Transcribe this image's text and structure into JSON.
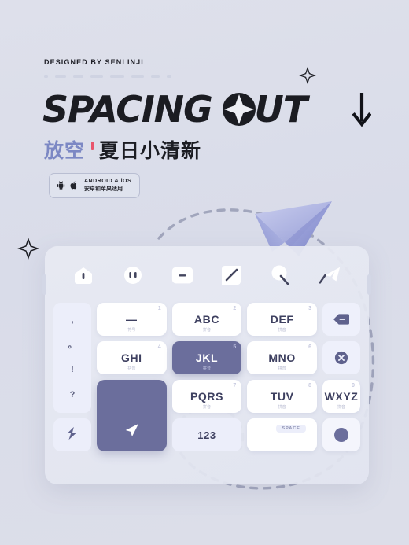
{
  "poster": {
    "background_color": "#dcdfea",
    "credit": "DESIGNED BY SENLINJI",
    "title_part1": "SPACING",
    "title_part2_before": "",
    "title_part2_after": "UT",
    "subtitle_accent": "放空",
    "subtitle_main": "夏日小清新",
    "accent_color": "#7c88c4",
    "tick_color": "#e9556d",
    "ink_color": "#1b1c22"
  },
  "badge": {
    "android_icon": "android-icon",
    "apple_icon": "apple-icon",
    "line_en": "ANDROID & iOS",
    "line_cn": "安卓和苹果适用"
  },
  "decorations": {
    "sparkle_top_right": "sparkle-icon",
    "sparkle_left": "sparkle-icon",
    "arrow_down": "arrow-down-icon",
    "paper_plane": "paper-plane-graphic",
    "dashed_trail": "dashed-trail"
  },
  "keyboard": {
    "toolbar": [
      {
        "name": "home-icon",
        "label": ""
      },
      {
        "name": "emoji-icon",
        "label": ""
      },
      {
        "name": "minimize-icon",
        "label": ""
      },
      {
        "name": "edit-icon",
        "label": ""
      },
      {
        "name": "search-icon",
        "label": ""
      },
      {
        "name": "send-icon",
        "label": ""
      }
    ],
    "punctuation_key": {
      "name": "punctuation-key",
      "symbols": [
        ",",
        "。",
        "!",
        "?"
      ]
    },
    "rows": [
      [
        {
          "main": "—",
          "corner": "1",
          "sub": "符号",
          "active": false,
          "name": "key-1"
        },
        {
          "main": "ABC",
          "corner": "2",
          "sub": "拼音",
          "active": false,
          "name": "key-abc"
        },
        {
          "main": "DEF",
          "corner": "3",
          "sub": "拼音",
          "active": false,
          "name": "key-def"
        }
      ],
      [
        {
          "main": "GHI",
          "corner": "4",
          "sub": "拼音",
          "active": false,
          "name": "key-ghi"
        },
        {
          "main": "JKL",
          "corner": "5",
          "sub": "拼音",
          "active": true,
          "name": "key-jkl"
        },
        {
          "main": "MNO",
          "corner": "6",
          "sub": "拼音",
          "active": false,
          "name": "key-mno"
        }
      ],
      [
        {
          "main": "PQRS",
          "corner": "7",
          "sub": "拼音",
          "active": false,
          "name": "key-pqrs"
        },
        {
          "main": "TUV",
          "corner": "8",
          "sub": "拼音",
          "active": false,
          "name": "key-tuv"
        },
        {
          "main": "WXYZ",
          "corner": "9",
          "sub": "拼音",
          "active": false,
          "name": "key-wxyz"
        }
      ]
    ],
    "right_column": [
      {
        "name": "backspace-key",
        "icon": "backspace-icon"
      },
      {
        "name": "clear-key",
        "icon": "circle-x-icon"
      },
      {
        "name": "send-key",
        "icon": "send-plane-icon"
      }
    ],
    "bottom_row": {
      "switch_key": {
        "name": "switch-input-key",
        "icon": "lightning-icon"
      },
      "number_key": {
        "name": "number-key",
        "label": "123"
      },
      "space_key": {
        "name": "space-key",
        "chip_label": "SPACE"
      },
      "round_key": {
        "name": "voice-key",
        "icon": "circle-blob-icon"
      }
    }
  }
}
